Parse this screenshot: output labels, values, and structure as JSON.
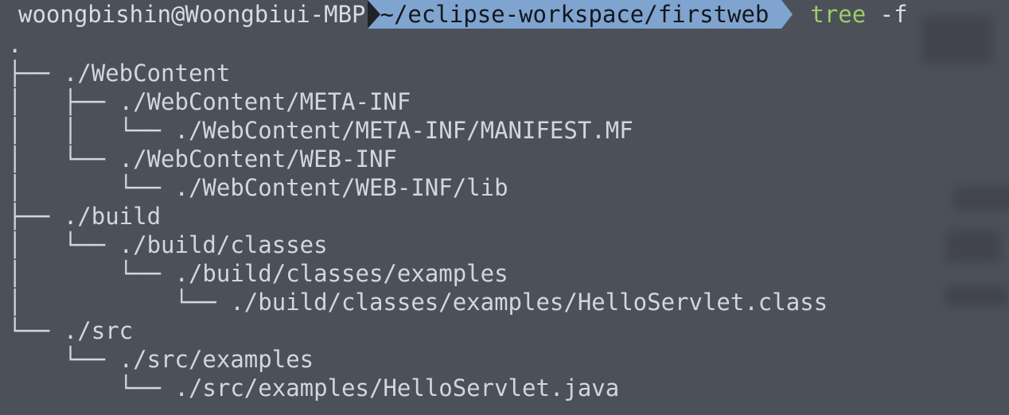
{
  "prompt": {
    "user_host": "woongbishin@Woongbiui-MBP",
    "path": "~/eclipse-workspace/firstweb",
    "command": "tree",
    "command_args": " -f"
  },
  "tree_lines": [
    ".",
    "├── ./WebContent",
    "│   ├── ./WebContent/META-INF",
    "│   │   └── ./WebContent/META-INF/MANIFEST.MF",
    "│   └── ./WebContent/WEB-INF",
    "│       └── ./WebContent/WEB-INF/lib",
    "├── ./build",
    "│   └── ./build/classes",
    "│       └── ./build/classes/examples",
    "│           └── ./build/classes/examples/HelloServlet.class",
    "└── ./src",
    "    └── ./src/examples",
    "        └── ./src/examples/HelloServlet.java"
  ],
  "colors": {
    "background": "#4c5058",
    "path_segment": "#7fa4d0",
    "command": "#9ccc6a",
    "text": "#d3d6dc"
  }
}
